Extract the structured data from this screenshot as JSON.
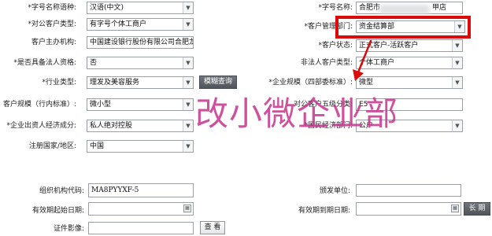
{
  "colors": {
    "annotation_red": "#d90b0b",
    "annotation_magenta": "#c7348e"
  },
  "left": {
    "language_label": "*字号名称语种:",
    "language_value": "汉语(中文)",
    "customer_type_label": "*对公客户类型:",
    "customer_type_value": "有字号个体工商户",
    "main_institution_label": "客户主办机构:",
    "main_institution_value": "中国建设银行股份有限公司合肥龙",
    "filing_label": "*是否具备法人资格:",
    "filing_value": "否",
    "industry_label": "*行业类型:",
    "industry_value": "理发及美容服务",
    "fuzzy_query_button": "模糊查询",
    "scale_label": "客户规模（行内标准）:",
    "scale_value": "微小型",
    "economy_label": "*企业出资人经济成分:",
    "economy_value": "私人绝对控股",
    "country_label": "注册国家/地区:",
    "country_value": "中国"
  },
  "right": {
    "name_label": "*字号名称:",
    "name_value_left": "合肥市",
    "name_value_right": "甲店",
    "dept_label": "*客户管理部门:",
    "dept_value": "资金结算部",
    "status_label": "*客户状态:",
    "status_value": "正式客户-活跃客户",
    "non_legal_type_label": "非法人客户类型:",
    "non_legal_type_value": "个体工商户",
    "enterprise_scale_label": "*企业规模（四部委标准）:",
    "enterprise_scale_value": "微型",
    "five_level_label": "对公客户五级分类:",
    "five_level_value": "E5",
    "nat_economy_label": "*国民经济部门:",
    "nat_economy_value": "公户"
  },
  "bottom": {
    "org_code_label": "组织机构代码:",
    "org_code_value": "MA8PYYXF-5",
    "issuing_unit_label": "颁发单位:",
    "issuing_unit_value": "",
    "valid_start_label": "有效期起始日期:",
    "valid_start_value": "",
    "valid_end_label": "有效期到期日期:",
    "valid_end_value": "",
    "long_term_button": "长 期",
    "cert_image_label": "证件影像:",
    "cert_image_value": "",
    "view_button": "查 看"
  },
  "annotation": {
    "text": "改小微企业部"
  }
}
